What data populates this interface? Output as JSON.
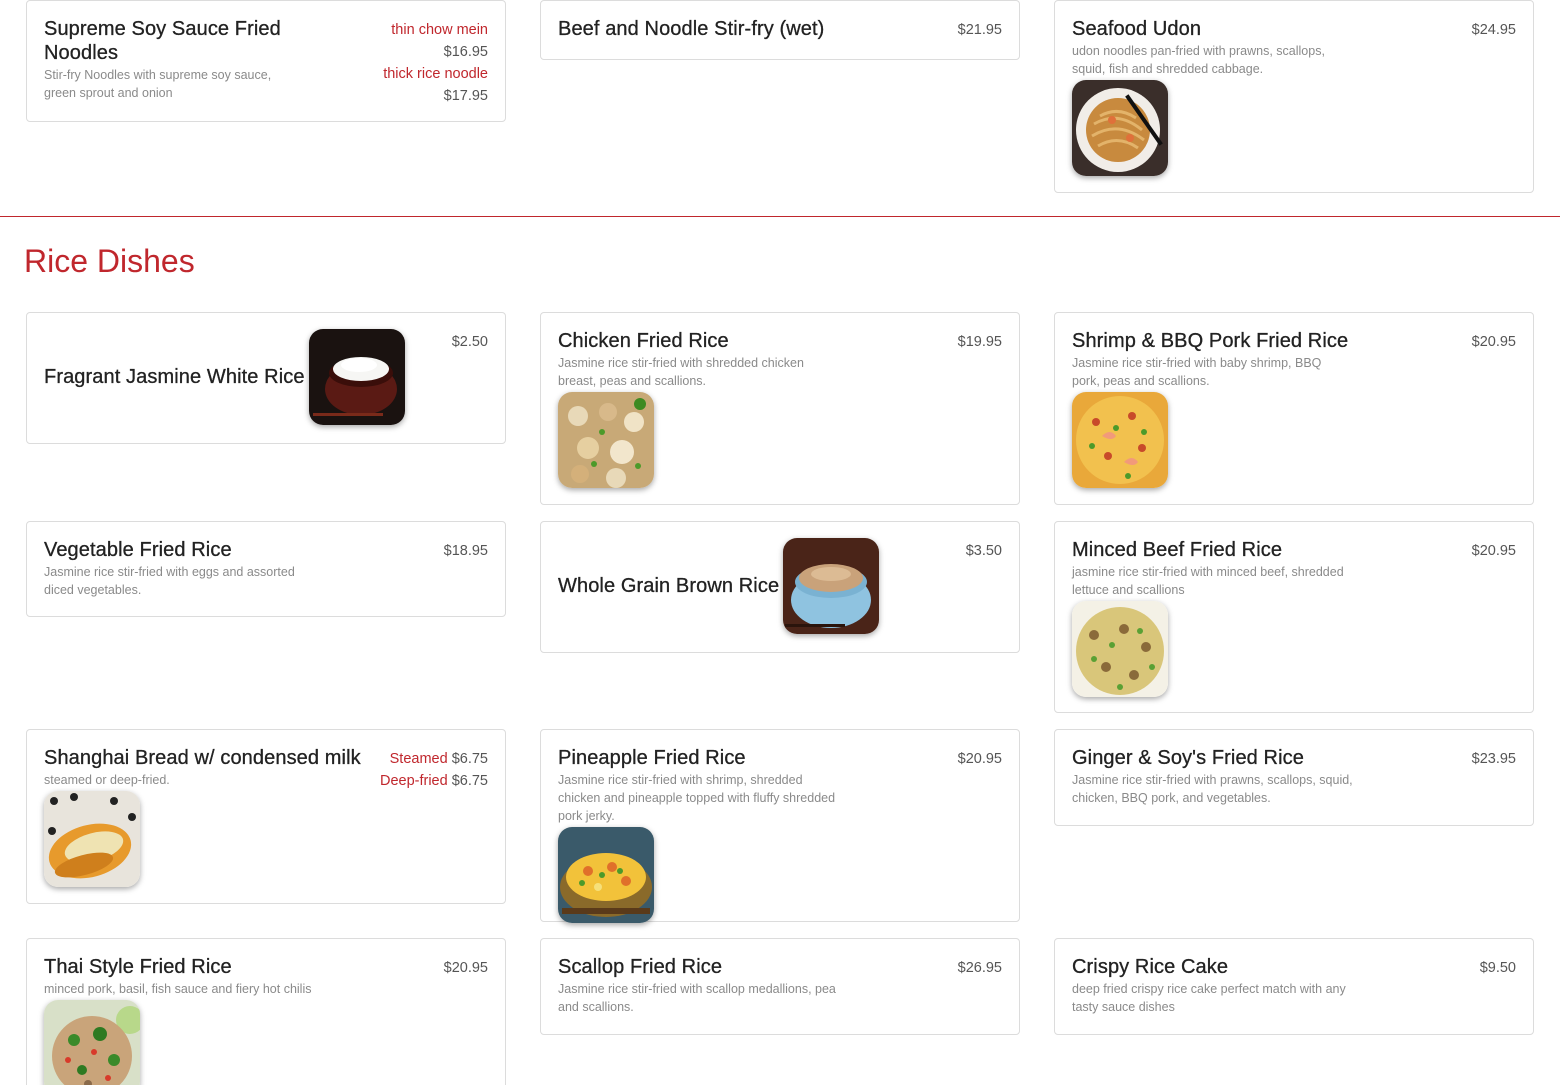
{
  "noodles_tail": {
    "items": [
      {
        "name": "Supreme Soy Sauce Fried Noodles",
        "description": "Stir-fry Noodles with supreme soy sauce, green sprout and onion",
        "variants": [
          {
            "label": "thin chow mein",
            "price": "$16.95"
          },
          {
            "label": "thick rice noodle",
            "price": "$17.95"
          }
        ]
      },
      {
        "name": "Beef and Noodle Stir-fry (wet)",
        "price": "$21.95"
      },
      {
        "name": "Seafood Udon",
        "description": "udon noodles pan-fried with prawns, scallops, squid, fish and shredded cabbage.",
        "price": "$24.95",
        "image_icon": "udon-noodles-photo"
      }
    ]
  },
  "rice_section": {
    "title": "Rice Dishes",
    "items": [
      {
        "name": "Fragrant Jasmine White Rice",
        "price": "$2.50",
        "image_icon": "white-rice-bowl-photo"
      },
      {
        "name": "Chicken Fried Rice",
        "description": "Jasmine rice stir-fried with shredded chicken breast, peas and scallions.",
        "price": "$19.95",
        "image_icon": "chicken-fried-rice-photo"
      },
      {
        "name": "Shrimp & BBQ Pork Fried Rice",
        "description": "Jasmine rice stir-fried with baby shrimp, BBQ pork, peas and scallions.",
        "price": "$20.95",
        "image_icon": "shrimp-fried-rice-photo"
      },
      {
        "name": "Vegetable Fried Rice",
        "description": "Jasmine rice stir-fried with eggs and assorted diced vegetables.",
        "price": "$18.95"
      },
      {
        "name": "Whole Grain Brown Rice",
        "price": "$3.50",
        "image_icon": "brown-rice-bowl-photo"
      },
      {
        "name": "Minced Beef Fried Rice",
        "description": "jasmine rice stir-fried with minced beef, shredded lettuce and scallions",
        "price": "$20.95",
        "image_icon": "beef-fried-rice-photo"
      },
      {
        "name": "Shanghai Bread w/ condensed milk",
        "description": "steamed or deep-fried.",
        "variants": [
          {
            "label": "Steamed",
            "price": "$6.75"
          },
          {
            "label": "Deep-fried",
            "price": "$6.75"
          }
        ],
        "image_icon": "shanghai-bread-photo"
      },
      {
        "name": "Pineapple Fried Rice",
        "description": "Jasmine rice stir-fried with shrimp, shredded chicken and pineapple topped with fluffy shredded pork jerky.",
        "price": "$20.95",
        "image_icon": "pineapple-fried-rice-photo"
      },
      {
        "name": "Ginger & Soy's Fried Rice",
        "description": "Jasmine rice stir-fried with prawns, scallops, squid, chicken, BBQ pork, and vegetables.",
        "price": "$23.95"
      },
      {
        "name": "Thai Style Fried Rice",
        "description": "minced pork, basil, fish sauce and fiery hot chilis",
        "price": "$20.95",
        "image_icon": "thai-fried-rice-photo"
      },
      {
        "name": "Scallop Fried Rice",
        "description": "Jasmine rice stir-fried with scallop medallions, pea and scallions.",
        "price": "$26.95"
      },
      {
        "name": "Crispy Rice Cake",
        "description": "deep fried crispy rice cake perfect match with any tasty sauce dishes",
        "price": "$9.50"
      }
    ]
  },
  "colors": {
    "accent": "#c0272d",
    "text": "#222222",
    "muted": "#8a8a8a",
    "border": "#dcdcdc"
  }
}
